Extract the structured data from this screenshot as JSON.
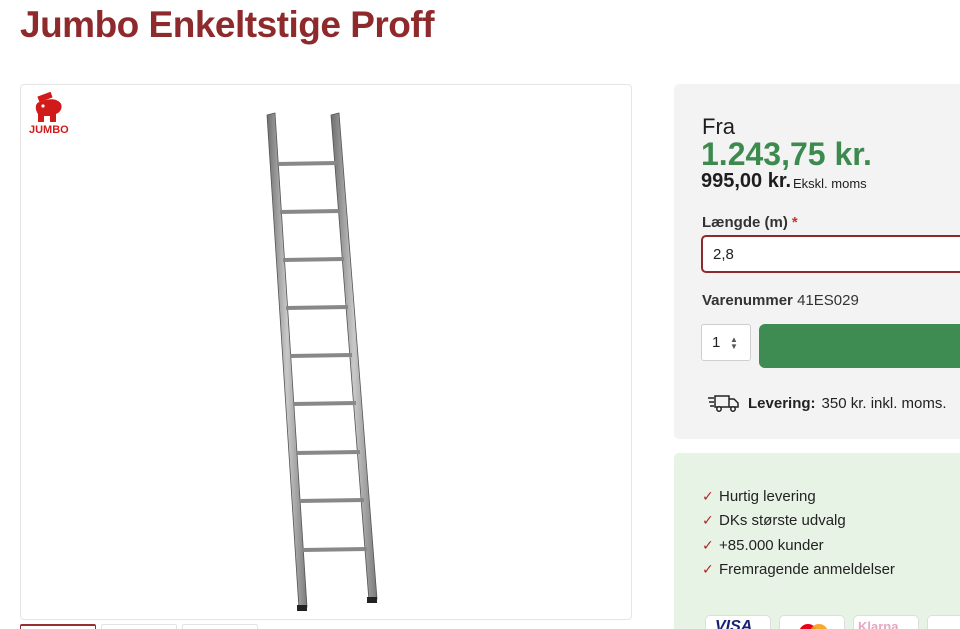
{
  "product": {
    "title": "Jumbo Enkeltstige Proff",
    "brand_logo_text": "JUMBO"
  },
  "gallery": {
    "main_image": "ladder-image",
    "thumbnail_count": 3
  },
  "pricing": {
    "from_label": "Fra",
    "price_incl": "1.243,75 kr.",
    "price_excl": "995,00 kr.",
    "price_excl_note": "Ekskl. moms"
  },
  "options": {
    "length_label": "Længde (m)",
    "required_mark": "*",
    "length_value": "2,8"
  },
  "sku": {
    "label": "Varenummer",
    "value": "41ES029"
  },
  "cart": {
    "quantity": "1"
  },
  "delivery": {
    "icon": "truck-icon",
    "label": "Levering:",
    "value": "350 kr. inkl. moms."
  },
  "usps": [
    "Hurtig levering",
    "DKs største udvalg",
    "+85.000 kunder",
    "Fremragende anmeldelser"
  ],
  "payment": {
    "visa": "VISA",
    "klarna": "Klarna."
  },
  "colors": {
    "title": "#8e2a2c",
    "price": "#3d8a4f",
    "button": "#3e8c51",
    "usp_bg": "#e7f3e5",
    "check": "#b3262a"
  }
}
